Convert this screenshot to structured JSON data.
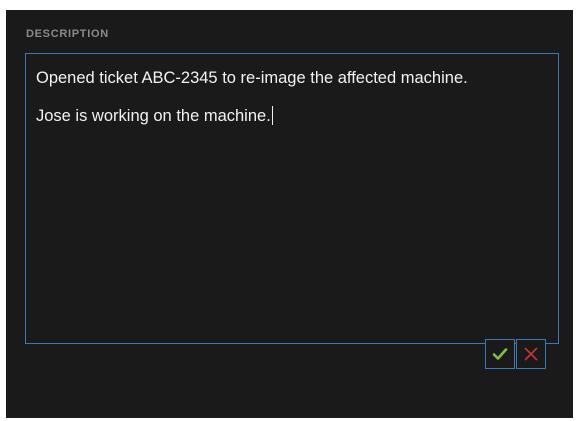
{
  "description": {
    "label": "DESCRIPTION",
    "paragraphs": [
      "Opened ticket ABC-2345 to re-image the affected machine.",
      "Jose is working on the machine."
    ]
  },
  "actions": {
    "confirm_icon": "checkmark-icon",
    "cancel_icon": "x-icon"
  },
  "colors": {
    "panel_bg": "#1a1a1a",
    "border": "#3b78b8",
    "confirm": "#7ec440",
    "cancel": "#c73434",
    "label": "#8a8a8a",
    "text": "#f2f2f2"
  }
}
